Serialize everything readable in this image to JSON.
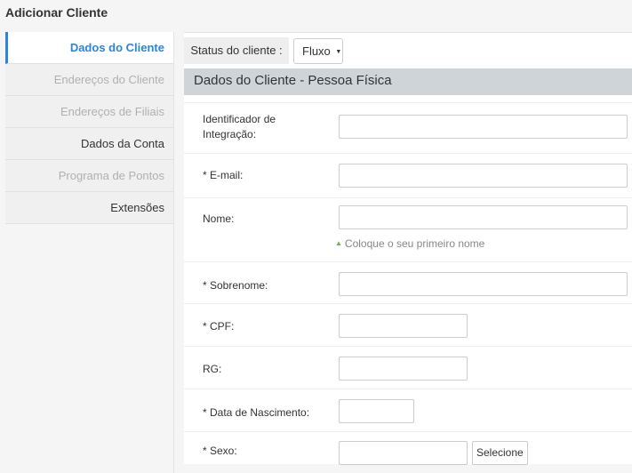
{
  "page": {
    "title": "Adicionar Cliente"
  },
  "sidebar": {
    "items": [
      {
        "label": "Dados do Cliente",
        "state": "active"
      },
      {
        "label": "Endereços do Cliente",
        "state": "disabled"
      },
      {
        "label": "Endereços de Filiais",
        "state": "disabled"
      },
      {
        "label": "Dados da Conta",
        "state": "normal"
      },
      {
        "label": "Programa de Pontos",
        "state": "disabled"
      },
      {
        "label": "Extensões",
        "state": "normal"
      }
    ]
  },
  "status": {
    "label": "Status do cliente :",
    "value": "Fluxo"
  },
  "section": {
    "title": "Dados do Cliente - Pessoa Física"
  },
  "form": {
    "integration_label": "Identificador de Integração:",
    "integration_value": "",
    "email_label": "* E-mail:",
    "email_value": "",
    "name_label": "Nome:",
    "name_value": "",
    "name_hint": "Coloque o seu primeiro nome",
    "surname_label": "* Sobrenome:",
    "surname_value": "",
    "cpf_label": "* CPF:",
    "cpf_value": "",
    "rg_label": "RG:",
    "rg_value": "",
    "birth_label": "* Data de Nascimento:",
    "birth_value": "",
    "sex_label": "* Sexo:",
    "sex_value": "",
    "sex_button": "Selecione"
  },
  "colors": {
    "accent": "#2b85d8",
    "header_bg": "#cfd4d9",
    "hint_marker": "#6ab04c"
  },
  "icons": {
    "select_caret": "caret-down-icon",
    "hint_marker": "triangle-up-icon"
  }
}
